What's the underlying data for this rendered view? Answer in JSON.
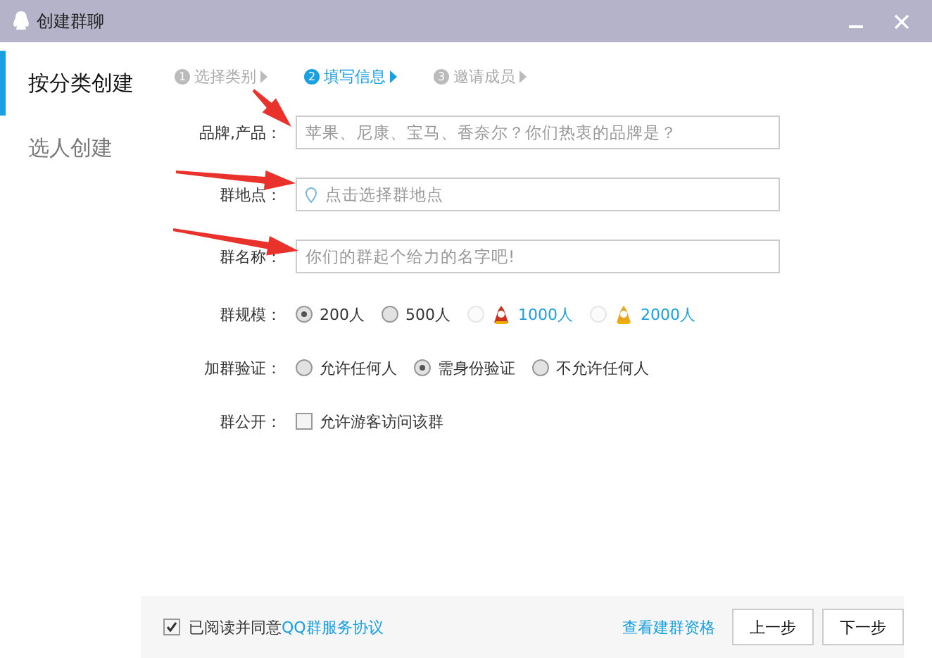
{
  "window": {
    "title": "创建群聊"
  },
  "sidebar": {
    "items": [
      {
        "label": "按分类创建",
        "selected": true
      },
      {
        "label": "选人创建",
        "selected": false
      }
    ]
  },
  "steps": [
    {
      "number": "1",
      "label": "选择类别",
      "selected": false
    },
    {
      "number": "2",
      "label": "填写信息",
      "selected": true
    },
    {
      "number": "3",
      "label": "邀请成员",
      "selected": false
    }
  ],
  "fields": [
    {
      "label": "品牌,产品：",
      "placeholder": "苹果、尼康、宝马、香奈尔？你们热衷的品牌是？",
      "kind": "text"
    },
    {
      "label": "群地点：",
      "placeholder": "点击选择群地点",
      "kind": "location"
    },
    {
      "label": "群名称：",
      "placeholder": "你们的群起个给力的名字吧!",
      "kind": "text"
    }
  ],
  "options": [
    {
      "label": "群规模：",
      "kind": "radio",
      "choices": [
        {
          "label": "200人",
          "selected": true,
          "disabled": false,
          "vip": false
        },
        {
          "label": "500人",
          "selected": false,
          "disabled": false,
          "vip": false
        },
        {
          "label": "1000人",
          "selected": false,
          "disabled": true,
          "vip": true
        },
        {
          "label": "2000人",
          "selected": false,
          "disabled": true,
          "vip": true
        }
      ]
    },
    {
      "label": "加群验证：",
      "kind": "radio",
      "choices": [
        {
          "label": "允许任何人",
          "selected": false,
          "disabled": false,
          "vip": false
        },
        {
          "label": "需身份验证",
          "selected": true,
          "disabled": false,
          "vip": false
        },
        {
          "label": "不允许任何人",
          "selected": false,
          "disabled": false,
          "vip": false
        }
      ]
    },
    {
      "label": "群公开：",
      "kind": "checkbox",
      "choices": [
        {
          "label": "允许游客访问该群",
          "selected": false
        }
      ]
    }
  ],
  "footer": {
    "agree_checked": true,
    "agree_text": "已阅读并同意",
    "agree_link": "QQ群服务协议",
    "eligibility_link": "查看建群资格",
    "buttons": [
      "上一步",
      "下一步"
    ]
  }
}
